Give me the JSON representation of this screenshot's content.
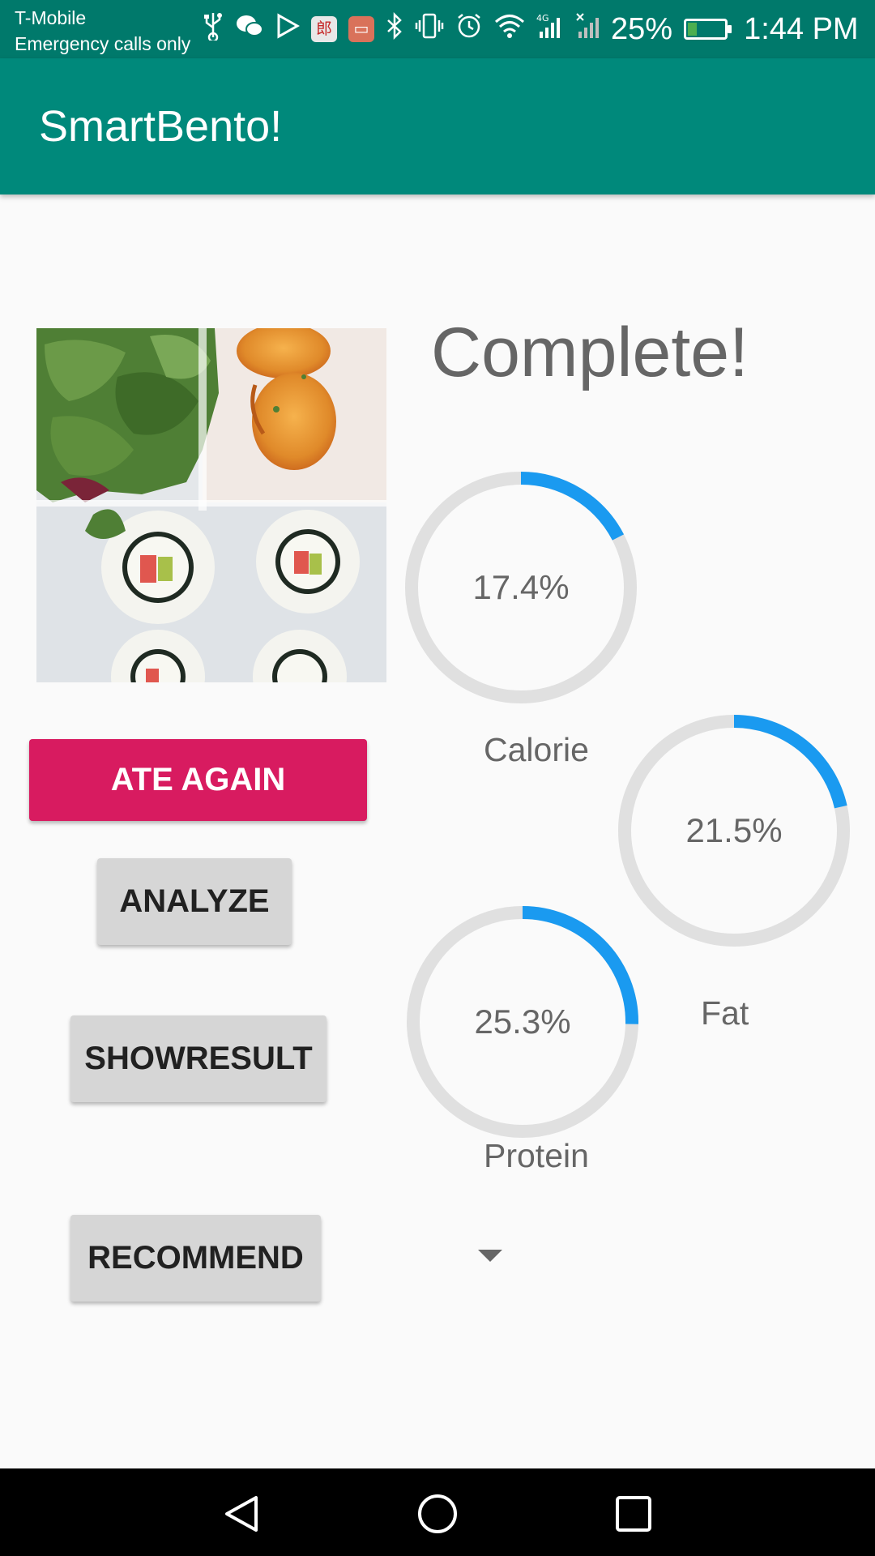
{
  "status_bar": {
    "carrier": "T-Mobile",
    "network_note": "Emergency calls only",
    "notification_icons": [
      "usb-icon",
      "wechat-icon",
      "play-store-icon",
      "mail-app-icon",
      "inbox-app-icon"
    ],
    "system_icons": [
      "bluetooth-icon",
      "vibrate-icon",
      "alarm-icon",
      "wifi-icon",
      "signal-4g-icon",
      "signal-icon"
    ],
    "network_type": "4G",
    "battery_percent": "25%",
    "battery_level": 0.25,
    "battery_charging": true,
    "time": "1:44 PM"
  },
  "app_bar": {
    "title": "SmartBento!"
  },
  "main": {
    "status_text": "Complete!",
    "photo_description_icon": "bento-photo",
    "rings": [
      {
        "id": "calorie",
        "percent_text": "17.4%",
        "value": 17.4,
        "label": "Calorie"
      },
      {
        "id": "fat",
        "percent_text": "21.5%",
        "value": 21.5,
        "label": "Fat"
      },
      {
        "id": "protein",
        "percent_text": "25.3%",
        "value": 25.3,
        "label": "Protein"
      }
    ],
    "buttons": {
      "ate_again": "ATE AGAIN",
      "analyze": "ANALYZE",
      "show_result": "SHOWRESULT",
      "recommend": "RECOMMEND"
    },
    "spinner_icon": "dropdown-arrow-icon"
  },
  "colors": {
    "primary": "#00897b",
    "primary_dark": "#00796b",
    "accent": "#d81b60",
    "progress": "#1a9af0",
    "track": "#e0e0e0",
    "button_gray": "#d6d6d6"
  },
  "nav_bar": {
    "icons": [
      "back-icon",
      "home-icon",
      "recents-icon"
    ]
  }
}
